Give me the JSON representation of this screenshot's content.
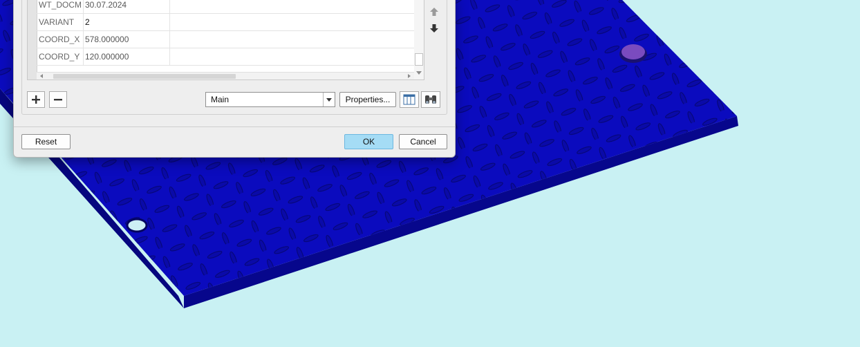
{
  "table": {
    "rows": [
      {
        "name": "WT_DOCM",
        "value": "30.07.2024"
      },
      {
        "name": "VARIANT",
        "value": "2"
      },
      {
        "name": "COORD_X",
        "value": "578.000000"
      },
      {
        "name": "COORD_Y",
        "value": "120.000000"
      }
    ]
  },
  "toolbar": {
    "add_icon": "plus-icon",
    "remove_icon": "minus-icon",
    "view_select_value": "Main",
    "properties_label": "Properties...",
    "columns_icon": "table-columns-icon",
    "find_icon": "binoculars-icon"
  },
  "side": {
    "move_up_icon": "arrow-up-icon",
    "move_down_icon": "arrow-down-icon"
  },
  "footer": {
    "reset_label": "Reset",
    "ok_label": "OK",
    "cancel_label": "Cancel"
  },
  "colors": {
    "model": "#0a0ab8",
    "background": "#c9f1f3",
    "ok_button": "#a5dcf5",
    "hole_marker": "#7a4bbf"
  }
}
